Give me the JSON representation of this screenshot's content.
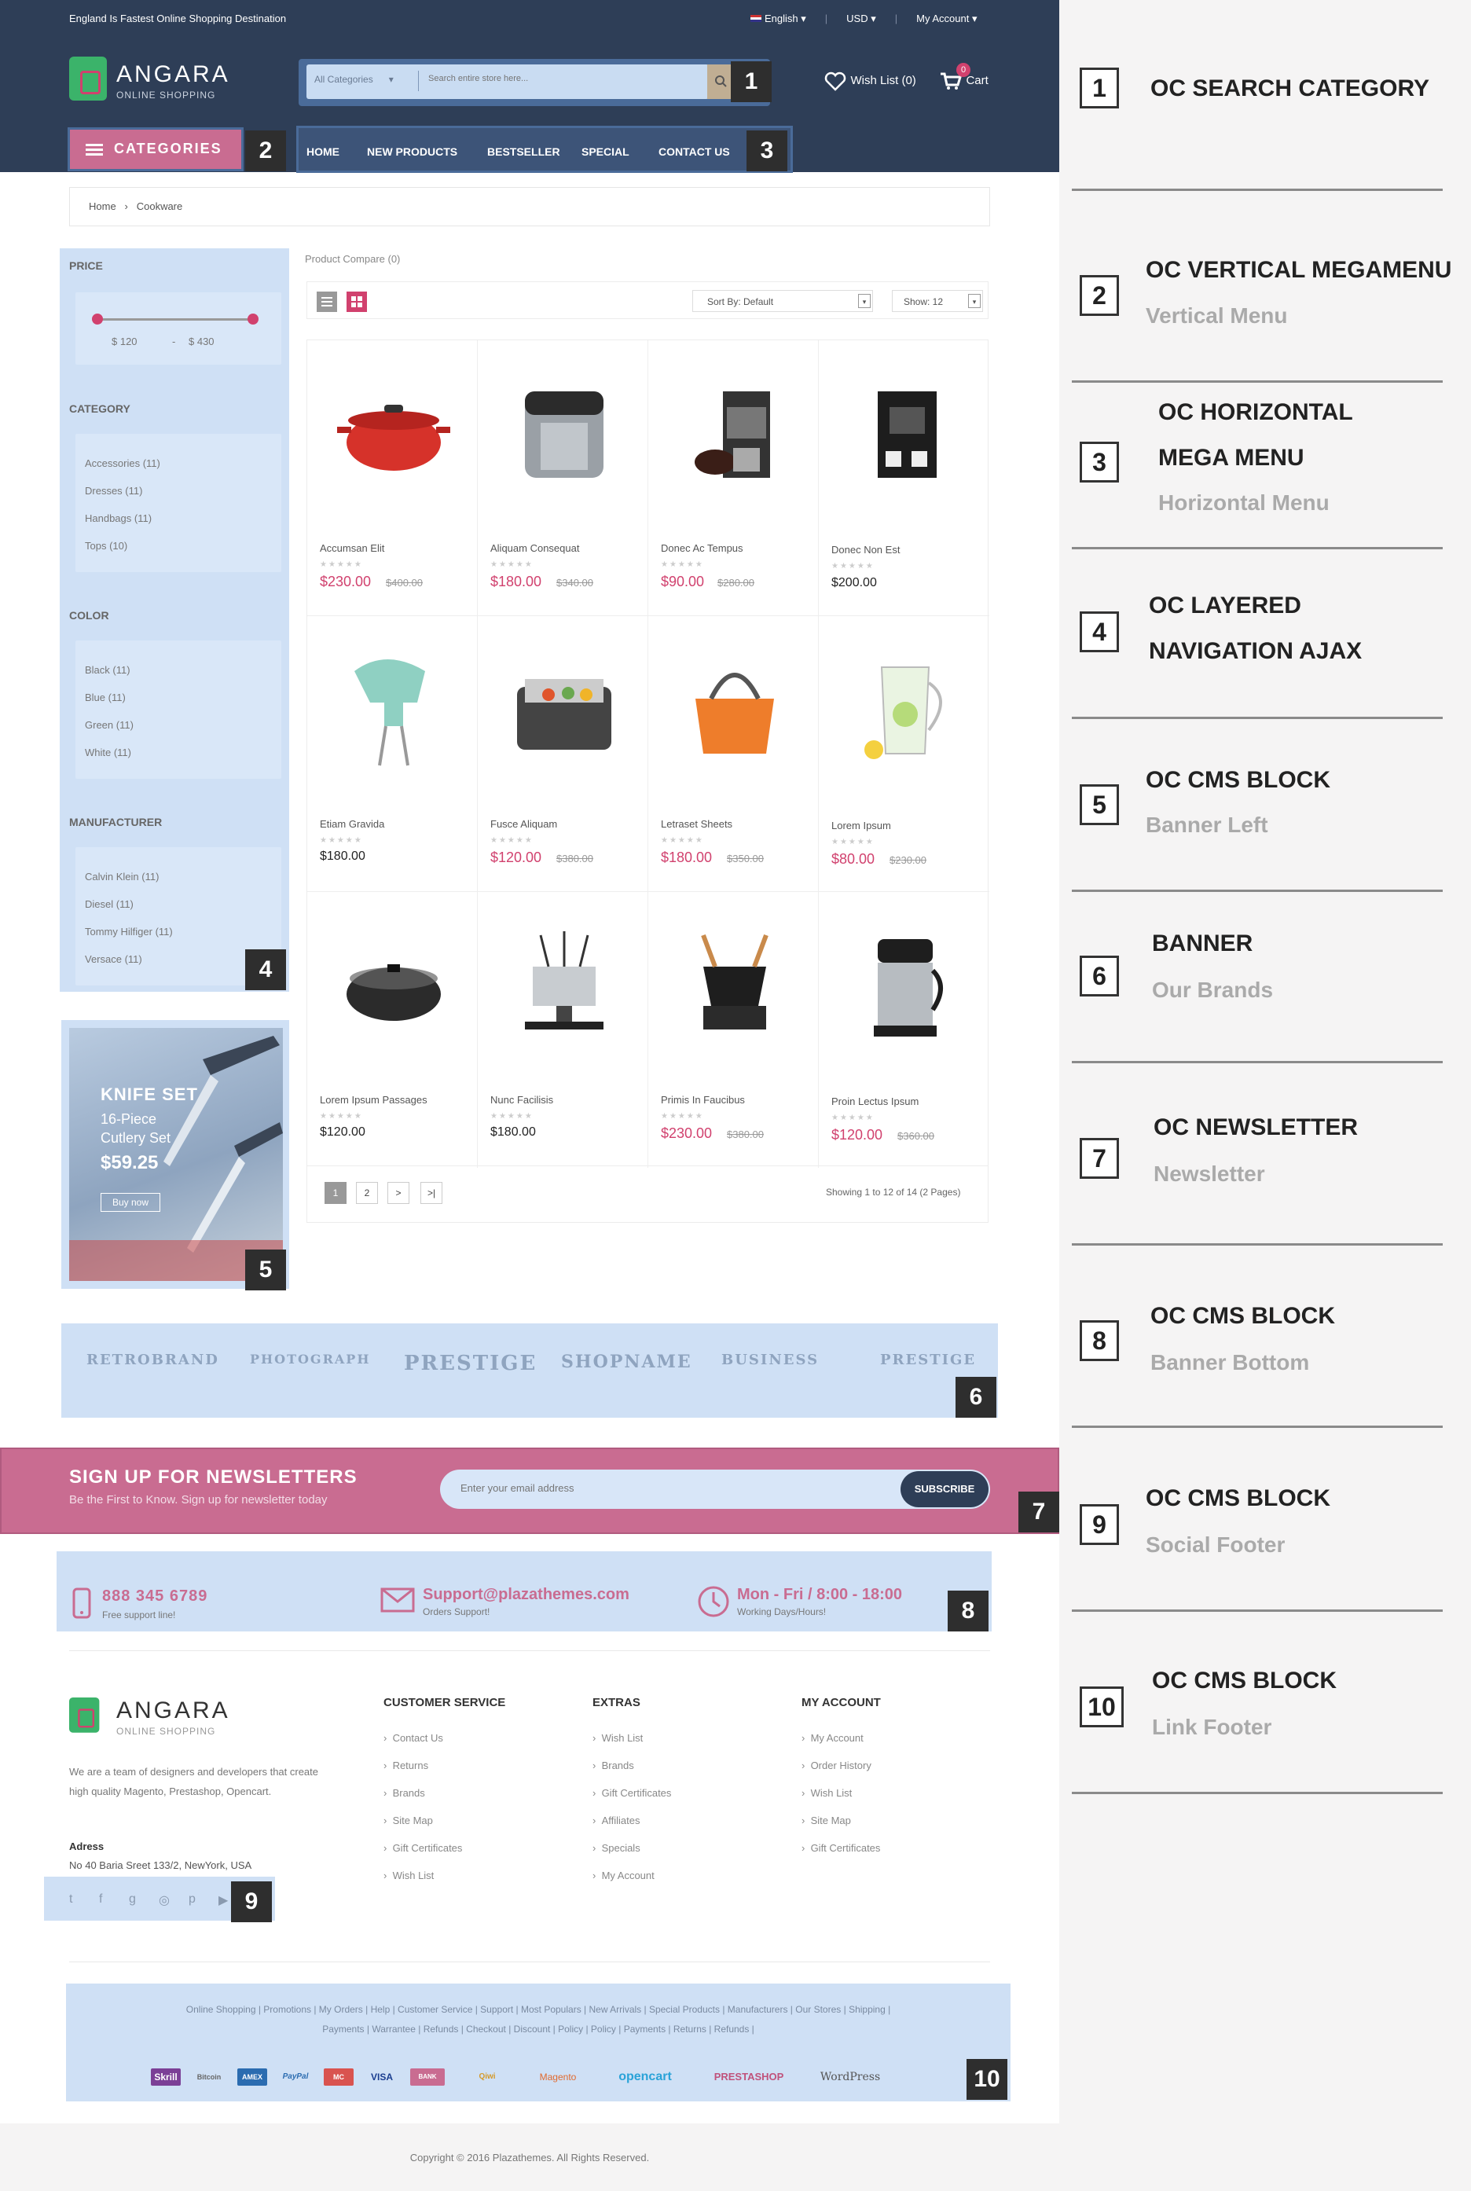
{
  "topbar": {
    "tagline": "England Is Fastest Online Shopping Destination",
    "language": "English",
    "currency": "USD",
    "account": "My Account"
  },
  "logo": {
    "title": "ANGARA",
    "subtitle": "ONLINE SHOPPING"
  },
  "search": {
    "category": "All Categories",
    "placeholder": "Search entire store here..."
  },
  "header": {
    "wishlist": "Wish List (0)",
    "cart": "Cart",
    "cart_count": "0"
  },
  "nav": {
    "categories": "CATEGORIES",
    "menu": [
      "HOME",
      "NEW PRODUCTS",
      "BESTSELLER",
      "SPECIAL",
      "CONTACT US"
    ]
  },
  "breadcrumb": {
    "home": "Home",
    "current": "Cookware"
  },
  "sidebar": {
    "price_title": "PRICE",
    "price_min": "$ 120",
    "price_sep": "-",
    "price_max": "$ 430",
    "category_title": "CATEGORY",
    "categories": [
      "Accessories (11)",
      "Dresses (11)",
      "Handbags (11)",
      "Tops (10)"
    ],
    "color_title": "COLOR",
    "colors": [
      "Black (11)",
      "Blue (11)",
      "Green (11)",
      "White (11)"
    ],
    "manufacturer_title": "MANUFACTURER",
    "manufacturers": [
      "Calvin Klein (11)",
      "Diesel (11)",
      "Tommy Hilfiger (11)",
      "Versace (11)"
    ]
  },
  "banner_left": {
    "title": "KNIFE SET",
    "line1": "16-Piece",
    "line2": "Cutlery Set",
    "price": "$59.25",
    "button": "Buy now"
  },
  "toolbar": {
    "compare": "Product Compare (0)",
    "sort": "Sort By: Default",
    "show": "Show: 12"
  },
  "products": [
    {
      "name": "Accumsan Elit",
      "price": "$230.00",
      "old": "$400.00"
    },
    {
      "name": "Aliquam Consequat",
      "price": "$180.00",
      "old": "$340.00"
    },
    {
      "name": "Donec Ac Tempus",
      "price": "$90.00",
      "old": "$280.00"
    },
    {
      "name": "Donec Non Est",
      "price": "$200.00",
      "old": ""
    },
    {
      "name": "Etiam Gravida",
      "price": "$180.00",
      "old": ""
    },
    {
      "name": "Fusce Aliquam",
      "price": "$120.00",
      "old": "$380.00"
    },
    {
      "name": "Letraset Sheets",
      "price": "$180.00",
      "old": "$350.00"
    },
    {
      "name": "Lorem Ipsum",
      "price": "$80.00",
      "old": "$230.00"
    },
    {
      "name": "Lorem Ipsum Passages",
      "price": "$120.00",
      "old": ""
    },
    {
      "name": "Nunc Facilisis",
      "price": "$180.00",
      "old": ""
    },
    {
      "name": "Primis In Faucibus",
      "price": "$230.00",
      "old": "$380.00"
    },
    {
      "name": "Proin Lectus Ipsum",
      "price": "$120.00",
      "old": "$360.00"
    }
  ],
  "pagination": {
    "pages": [
      "1",
      "2",
      ">",
      ">|"
    ],
    "summary": "Showing 1 to 12 of 14 (2 Pages)"
  },
  "brands": [
    "RETROBRAND",
    "PHOTOGRAPH",
    "PRESTIGE",
    "SHOPNAME",
    "BUSINESS",
    "PRESTIGE"
  ],
  "newsletter": {
    "title": "SIGN UP FOR NEWSLETTERS",
    "subtitle": "Be the First to Know. Sign up for newsletter today",
    "placeholder": "Enter your email address",
    "button": "SUBSCRIBE"
  },
  "contact": [
    {
      "title": "888 345 6789",
      "sub": "Free support line!"
    },
    {
      "title": "Support@plazathemes.com",
      "sub": "Orders Support!"
    },
    {
      "title": "Mon - Fri / 8:00 - 18:00",
      "sub": "Working Days/Hours!"
    }
  ],
  "footer": {
    "about": "We are a team of designers and developers that create high quality Magento, Prestashop, Opencart.",
    "address_label": "Adress",
    "address": "No 40 Baria Sreet 133/2, NewYork, USA",
    "customer_title": "CUSTOMER SERVICE",
    "customer": [
      "Contact Us",
      "Returns",
      "Brands",
      "Site Map",
      "Gift Certificates",
      "Wish List"
    ],
    "extras_title": "EXTRAS",
    "extras": [
      "Wish List",
      "Brands",
      "Gift Certificates",
      "Affiliates",
      "Specials",
      "My Account"
    ],
    "account_title": "MY ACCOUNT",
    "account": [
      "My Account",
      "Order History",
      "Wish List",
      "Site Map",
      "Gift Certificates"
    ],
    "links_row1": "Online Shopping | Promotions | My Orders | Help | Customer Service | Support | Most Populars | New Arrivals | Special Products | Manufacturers | Our Stores | Shipping |",
    "links_row2": "Payments | Warrantee | Refunds | Checkout | Discount | Policy | Policy | Payments | Returns | Refunds |",
    "payments": [
      "Skrill",
      "Bitcoin",
      "AMEX",
      "PayPal",
      "MC",
      "VISA",
      "BANK",
      "Qiwi",
      "Magento",
      "opencart",
      "PRESTASHOP",
      "WordPress"
    ],
    "copyright": "Copyright © 2016 Plazathemes. All Rights Reserved."
  },
  "annotations": [
    {
      "num": "1",
      "title1": "OC SEARCH CATEGORY",
      "title2": "",
      "sub": ""
    },
    {
      "num": "2",
      "title1": "OC VERTICAL MEGAMENU",
      "title2": "",
      "sub": "Vertical Menu"
    },
    {
      "num": "3",
      "title1": "OC HORIZONTAL",
      "title2": "MEGA MENU",
      "sub": "Horizontal Menu"
    },
    {
      "num": "4",
      "title1": "OC LAYERED",
      "title2": "NAVIGATION AJAX",
      "sub": ""
    },
    {
      "num": "5",
      "title1": "OC CMS BLOCK",
      "title2": "",
      "sub": "Banner Left"
    },
    {
      "num": "6",
      "title1": "BANNER",
      "title2": "",
      "sub": "Our Brands"
    },
    {
      "num": "7",
      "title1": "OC NEWSLETTER",
      "title2": "",
      "sub": "Newsletter"
    },
    {
      "num": "8",
      "title1": "OC CMS BLOCK",
      "title2": "",
      "sub": "Banner Bottom"
    },
    {
      "num": "9",
      "title1": "OC CMS BLOCK",
      "title2": "",
      "sub": "Social Footer"
    },
    {
      "num": "10",
      "title1": "OC CMS BLOCK",
      "title2": "",
      "sub": "Link Footer"
    }
  ],
  "colors": {
    "navy": "#2e3e57",
    "pink": "#c96c91",
    "price": "#d1416e",
    "panel": "#cfe0f5"
  }
}
